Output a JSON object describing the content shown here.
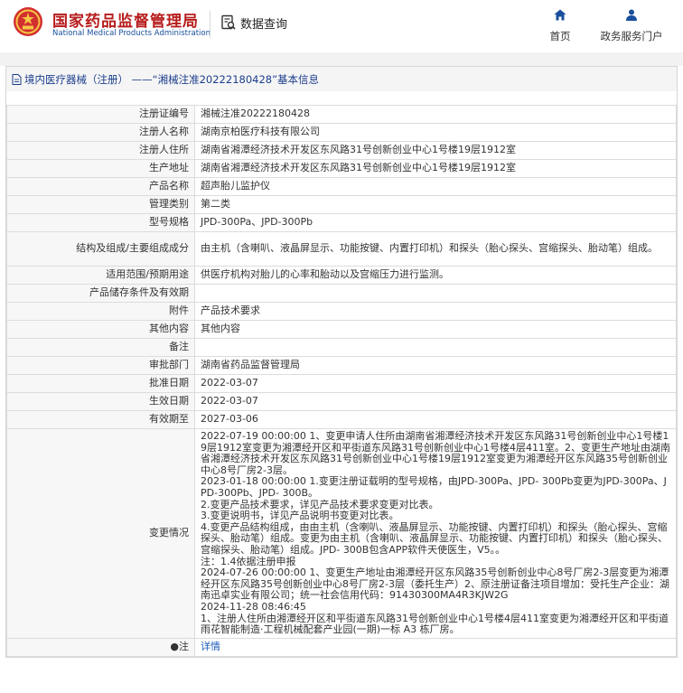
{
  "header": {
    "brand_cn": "国家药品监督管理局",
    "brand_en": "National Medical Products Administration",
    "search_label": "数据查询",
    "nav": [
      {
        "label": "首页",
        "icon": "home-icon"
      },
      {
        "label": "政务服务门户",
        "icon": "user-icon"
      }
    ]
  },
  "breadcrumb": {
    "text": "境内医疗器械（注册） ——“湘械注准20222180428”基本信息"
  },
  "table": {
    "rows": [
      {
        "label": "注册证编号",
        "value": "湘械注准20222180428"
      },
      {
        "label": "注册人名称",
        "value": "湖南京柏医疗科技有限公司"
      },
      {
        "label": "注册人住所",
        "value": "湖南省湘潭经济技术开发区东风路31号创新创业中心1号楼19层1912室"
      },
      {
        "label": "生产地址",
        "value": "湖南省湘潭经济技术开发区东风路31号创新创业中心1号楼19层1912室"
      },
      {
        "label": "产品名称",
        "value": "超声胎儿监护仪"
      },
      {
        "label": "管理类别",
        "value": "第二类"
      },
      {
        "label": "型号规格",
        "value": "JPD-300Pa、JPD-300Pb"
      },
      {
        "label": "结构及组成/主要组成成分",
        "value": "由主机（含喇叭、液晶屏显示、功能按键、内置打印机）和探头（胎心探头、宫缩探头、胎动笔）组成。"
      },
      {
        "label": "适用范围/预期用途",
        "value": "供医疗机构对胎儿的心率和胎动以及宫缩压力进行监测。"
      },
      {
        "label": "产品储存条件及有效期",
        "value": ""
      },
      {
        "label": "附件",
        "value": "产品技术要求"
      },
      {
        "label": "其他内容",
        "value": "其他内容"
      },
      {
        "label": "备注",
        "value": ""
      },
      {
        "label": "审批部门",
        "value": "湖南省药品监督管理局"
      },
      {
        "label": "批准日期",
        "value": "2022-03-07"
      },
      {
        "label": "生效日期",
        "value": "2022-03-07"
      },
      {
        "label": "有效期至",
        "value": "2027-03-06"
      }
    ],
    "change_label": "变更情况",
    "change_lines": [
      "2022-07-19 00:00:00 1、变更申请人住所由湖南省湘潭经济技术开发区东风路31号创新创业中心1号楼19层1912室变更为湘潭经开区和平街道东风路31号创新创业中心1号楼4层411室。2、变更生产地址由湖南省湘潭经济技术开发区东风路31号创新创业中心1号楼19层1912室变更为湘潭经开区东风路35号创新创业中心8号厂房2-3层。",
      "2023-01-18 00:00:00 1.变更注册证载明的型号规格，由JPD-300Pa、JPD- 300Pb变更为JPD-300Pa、JPD-300Pb、JPD- 300B。",
      "2.变更产品技术要求，详见产品技术要求变更对比表。",
      "3.变更说明书，详见产品说明书变更对比表。",
      "4.变更产品结构组成，由由主机（含喇叭、液晶屏显示、功能按键、内置打印机）和探头（胎心探头、宫缩探头、胎动笔）组成。变更为由主机（含喇叭、液晶屏显示、功能按键、内置打印机）和探头（胎心探头、宫缩探头、胎动笔）组成。JPD- 300B包含APP软件天使医生，V5。。",
      "注：1.4依据注册申报",
      "2024-07-26 00:00:00 1、变更生产地址由湘潭经开区东风路35号创新创业中心8号厂房2-3层变更为湘潭经开区东风路35号创新创业中心8号厂房2-3层（委托生产）2、原注册证备注项目增加：受托生产企业：湖南迅卓实业有限公司；统一社会信用代码：91430300MA4R3KJW2G",
      "2024-11-28 08:46:45",
      "1、注册人住所由湘潭经开区和平街道东风路31号创新创业中心1号楼4层411室变更为湘潭经开区和平街道雨花智能制造·工程机械配套产业园(一期)一标 A3 栋厂房。"
    ],
    "note_label": "注",
    "note_link": "详情"
  }
}
